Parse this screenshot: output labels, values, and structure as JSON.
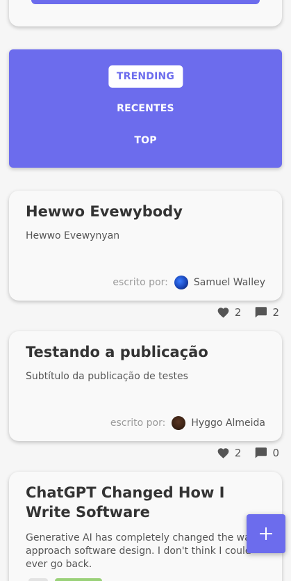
{
  "nav": {
    "items": [
      "TRENDING",
      "RECENTES",
      "TOP"
    ],
    "active": "TRENDING"
  },
  "posts": [
    {
      "title": "Hewwo Evewybody",
      "subtitle": "Hewwo Evewynyan",
      "author_label": "escrito por:",
      "author": "Samuel Walley",
      "likes": "2",
      "comments": "2"
    },
    {
      "title": "Testando a publicação",
      "subtitle": "Subtítulo da publicação de testes",
      "author_label": "escrito por:",
      "author": "Hyggo Almeida",
      "likes": "2",
      "comments": "0"
    },
    {
      "title": "ChatGPT Changed How I Write Software",
      "subtitle": "Generative AI has completely changed the way I approach software design. I don't think I could ever go back."
    }
  ],
  "icons": {
    "like": "heart-icon",
    "comment": "comment-icon",
    "fab": "plus-icon"
  },
  "colors": {
    "accent": "#6c6ced",
    "tag_green": "#9ad179"
  }
}
